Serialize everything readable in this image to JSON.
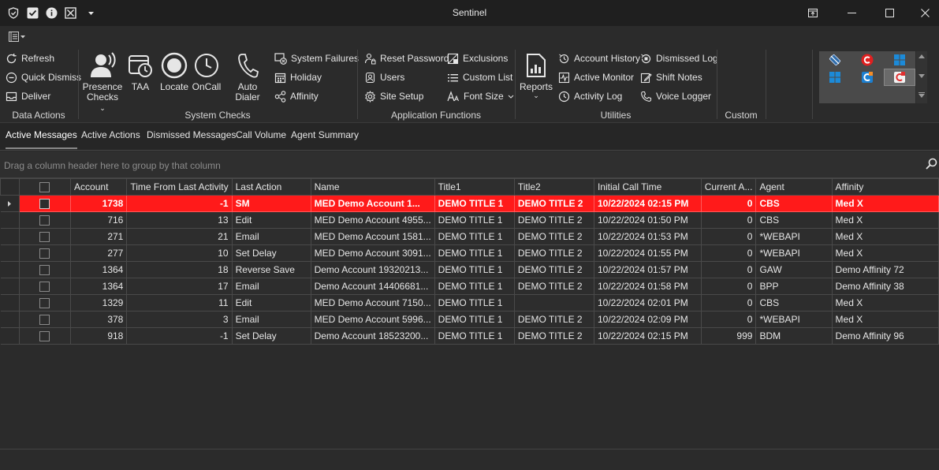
{
  "window": {
    "title": "Sentinel"
  },
  "ribbon": {
    "data_actions": {
      "label": "Data Actions",
      "refresh": "Refresh",
      "quick_dismiss": "Quick Dismiss",
      "deliver": "Deliver"
    },
    "system_checks": {
      "label": "System Checks",
      "presence_1": "Presence",
      "presence_2": "Checks",
      "taa": "TAA",
      "locate": "Locate",
      "oncall": "OnCall",
      "auto_dialer": "Auto Dialer",
      "system_failures": "System Failures",
      "holiday": "Holiday",
      "affinity": "Affinity"
    },
    "application_functions": {
      "label": "Application Functions",
      "reset_password": "Reset Password",
      "users": "Users",
      "site_setup": "Site Setup",
      "exclusions": "Exclusions",
      "custom_list": "Custom List",
      "font_size": "Font Size"
    },
    "utilities": {
      "label": "Utilities",
      "reports": "Reports",
      "account_history": "Account History",
      "active_monitor": "Active Monitor",
      "activity_log": "Activity Log",
      "dismissed_log": "Dismissed Log",
      "shift_notes": "Shift Notes",
      "voice_logger": "Voice Logger"
    },
    "custom": {
      "label": "Custom"
    }
  },
  "tabs": [
    "Active Messages",
    "Active Actions",
    "Dismissed Messages",
    "Call Volume",
    "Agent Summary"
  ],
  "active_tab": "Active Messages",
  "group_panel": {
    "hint": "Drag a column header here to group by that column"
  },
  "grid": {
    "columns": [
      "Account",
      "Time From Last Activity",
      "Last Action",
      "Name",
      "Title1",
      "Title2",
      "Initial Call Time",
      "Current A...",
      "Agent",
      "Affinity"
    ],
    "rows": [
      [
        "1738",
        "-1",
        "SM",
        "MED Demo Account 1...",
        "DEMO TITLE 1",
        "DEMO TITLE 2",
        "10/22/2024 02:15 PM",
        "0",
        "CBS",
        "Med X"
      ],
      [
        "716",
        "13",
        "Edit",
        "MED Demo Account 4955...",
        "DEMO TITLE 1",
        "DEMO TITLE 2",
        "10/22/2024 01:50 PM",
        "0",
        "CBS",
        "Med X"
      ],
      [
        "271",
        "21",
        "Email",
        "MED Demo Account 1581...",
        "DEMO TITLE 1",
        "DEMO TITLE 2",
        "10/22/2024 01:53 PM",
        "0",
        "*WEBAPI",
        "Med X"
      ],
      [
        "277",
        "10",
        "Set Delay",
        "MED Demo Account 3091...",
        "DEMO TITLE 1",
        "DEMO TITLE 2",
        "10/22/2024 01:55 PM",
        "0",
        "*WEBAPI",
        "Med X"
      ],
      [
        "1364",
        "18",
        "Reverse Save",
        "Demo Account 19320213...",
        "DEMO TITLE 1",
        "DEMO TITLE 2",
        "10/22/2024 01:57 PM",
        "0",
        "GAW",
        "Demo Affinity 72"
      ],
      [
        "1364",
        "17",
        "Email",
        "Demo Account 14406681...",
        "DEMO TITLE 1",
        "DEMO TITLE 2",
        "10/22/2024 01:58 PM",
        "0",
        "BPP",
        "Demo Affinity 38"
      ],
      [
        "1329",
        "11",
        "Edit",
        "MED Demo Account 7150...",
        "DEMO TITLE 1",
        "",
        "10/22/2024 02:01 PM",
        "0",
        "CBS",
        "Med X"
      ],
      [
        "378",
        "3",
        "Email",
        "MED Demo Account 5996...",
        "DEMO TITLE 1",
        "DEMO TITLE 2",
        "10/22/2024 02:09 PM",
        "0",
        "*WEBAPI",
        "Med X"
      ],
      [
        "918",
        "-1",
        "Set Delay",
        "Demo Account 18523200...",
        "DEMO TITLE 1",
        "DEMO TITLE 2",
        "10/22/2024 02:15 PM",
        "999",
        "BDM",
        "Demo Affinity 96"
      ]
    ],
    "selected_row": 0
  },
  "colors": {
    "selected_row": "#ff1a1a",
    "background": "#2b2b2b",
    "titlebar": "#1f1f1f"
  },
  "icons": {
    "titlebar": [
      "shield-icon",
      "checkbox-icon",
      "info-icon",
      "close-box-icon",
      "dropdown-arrow-icon"
    ],
    "window_controls": [
      "restore-icon",
      "minimize-icon",
      "maximize-icon",
      "close-icon"
    ],
    "gallery": [
      "satellite-icon",
      "c-logo-icon",
      "windows-icon",
      "windows-icon",
      "c-app-icon",
      "c-app-icon"
    ]
  }
}
